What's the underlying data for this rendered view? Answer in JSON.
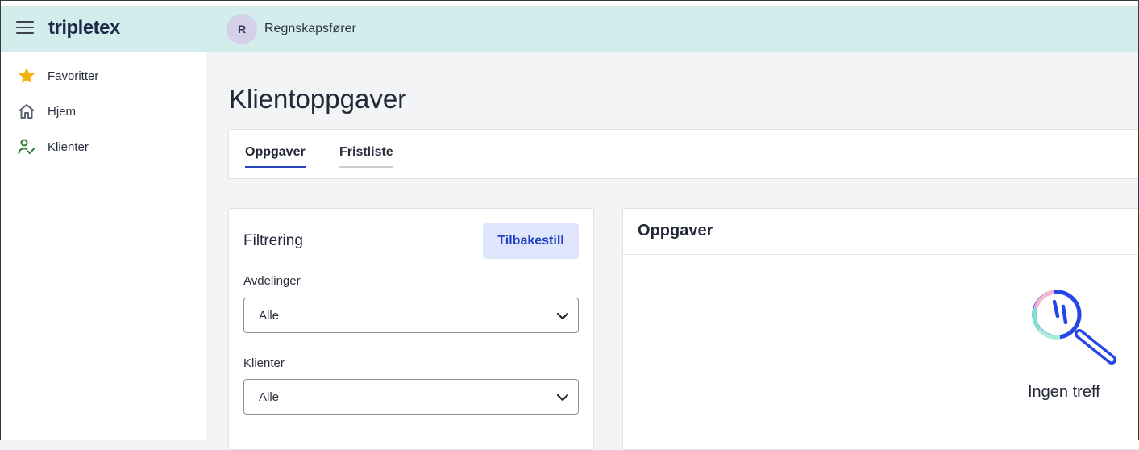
{
  "app": {
    "logo": "tripletex"
  },
  "header": {
    "user_initial": "R",
    "user_role": "Regnskapsfører"
  },
  "sidebar": {
    "items": [
      {
        "label": "Favoritter",
        "icon": "star-icon",
        "color": "#f2b40c"
      },
      {
        "label": "Hjem",
        "icon": "home-icon",
        "color": "#5d6371"
      },
      {
        "label": "Klienter",
        "icon": "client-check-icon",
        "color": "#2e7d32"
      }
    ]
  },
  "main": {
    "title": "Klientoppgaver",
    "tabs": [
      {
        "label": "Oppgaver",
        "active": true
      },
      {
        "label": "Fristliste",
        "active": false
      }
    ]
  },
  "filter": {
    "heading": "Filtrering",
    "reset_label": "Tilbakestill",
    "fields": [
      {
        "label": "Avdelinger",
        "value": "Alle"
      },
      {
        "label": "Klienter",
        "value": "Alle"
      }
    ]
  },
  "tasks": {
    "heading": "Oppgaver",
    "empty_icon": "magnifier-icon",
    "empty_text": "Ingen treff"
  },
  "colors": {
    "topbar_bg": "#d3ecec",
    "accent": "#2a47b8",
    "reset_bg": "#dfe6fb",
    "reset_text": "#1f3fc4"
  }
}
